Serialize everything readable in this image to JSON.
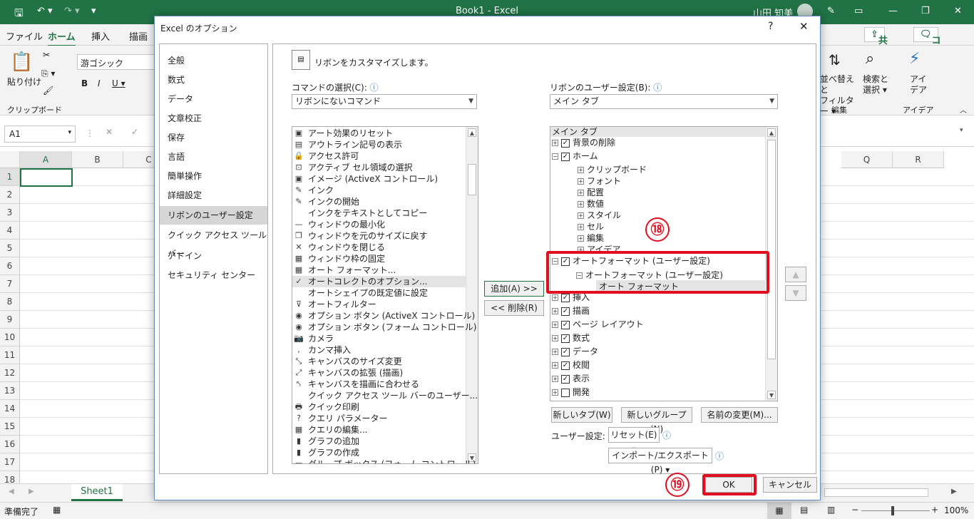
{
  "excel": {
    "window_title": "Book1  -  Excel",
    "user": "山田 知美",
    "tabs": [
      "ファイル",
      "ホーム",
      "挿入",
      "描画"
    ],
    "share": "共有",
    "comment": "コメント",
    "clipboard": {
      "paste": "貼り付け",
      "group": "クリップボード"
    },
    "font_name": "游ゴシック",
    "edit_group": {
      "sort": "並べ替えと",
      "filter": "フィルター",
      "find": "検索と",
      "select": "選択",
      "group": "編集"
    },
    "ideas": {
      "label": "アイ",
      "label2": "デア",
      "group": "アイデア"
    },
    "name_box": "A1",
    "columns": [
      "A",
      "B",
      "C",
      "Q",
      "R"
    ],
    "rows": [
      "1",
      "2",
      "3",
      "4",
      "5",
      "6",
      "7",
      "8",
      "9",
      "10",
      "11",
      "12",
      "13",
      "14",
      "15",
      "16",
      "17",
      "18"
    ],
    "sheet_tab": "Sheet1",
    "status": "準備完了",
    "zoom": "100%"
  },
  "dialog": {
    "title": "Excel のオプション",
    "help": "?",
    "close": "✕",
    "nav": [
      "全般",
      "数式",
      "データ",
      "文章校正",
      "保存",
      "言語",
      "簡単操作",
      "詳細設定",
      "リボンのユーザー設定",
      "クイック アクセス ツール バー",
      "アドイン",
      "セキュリティ センター"
    ],
    "heading": "リボンをカスタマイズします。",
    "commands_label": "コマンドの選択(C):",
    "commands_value": "リボンにないコマンド",
    "ribbon_label": "リボンのユーザー設定(B):",
    "ribbon_value": "メイン タブ",
    "command_list": [
      "アート効果のリセット",
      "アウトライン記号の表示",
      "アクセス許可",
      "アクティブ セル領域の選択",
      "イメージ (ActiveX コントロール)",
      "インク",
      "インクの開始",
      "インクをテキストとしてコピー",
      "ウィンドウの最小化",
      "ウィンドウを元のサイズに戻す",
      "ウィンドウを閉じる",
      "ウィンドウ枠の固定",
      "オート フォーマット...",
      "オートコレクトのオプション...",
      "オートシェイプの既定値に設定",
      "オートフィルター",
      "オプション ボタン (ActiveX コントロール)",
      "オプション ボタン (フォーム コントロール)",
      "カメラ",
      "カンマ挿入",
      "キャンバスのサイズ変更",
      "キャンバスの拡張 (描画)",
      "キャンバスを描画に合わせる",
      "クイック アクセス ツール バーのユーザー...",
      "クイック印刷",
      "クエリ パラメーター",
      "クエリの編集...",
      "グラフの追加",
      "グラフの作成",
      "グループ ボックス (フォーム コントロール)"
    ],
    "add_button": "追加(A) >>",
    "remove_button": "<< 削除(R)",
    "tree_header": "メイン タブ",
    "tree": [
      {
        "label": "背景の削除",
        "level": 0,
        "exp": "+",
        "chk": true
      },
      {
        "label": "ホーム",
        "level": 0,
        "exp": "−",
        "chk": true
      },
      {
        "label": "クリップボード",
        "level": 1,
        "exp": "+",
        "chk": false
      },
      {
        "label": "フォント",
        "level": 1,
        "exp": "+",
        "chk": false
      },
      {
        "label": "配置",
        "level": 1,
        "exp": "+",
        "chk": false
      },
      {
        "label": "数値",
        "level": 1,
        "exp": "+",
        "chk": false
      },
      {
        "label": "スタイル",
        "level": 1,
        "exp": "+",
        "chk": false
      },
      {
        "label": "セル",
        "level": 1,
        "exp": "+",
        "chk": false
      },
      {
        "label": "編集",
        "level": 1,
        "exp": "+",
        "chk": false
      },
      {
        "label": "アイデア",
        "level": 1,
        "exp": "+",
        "chk": false
      }
    ],
    "tree_custom": {
      "tab": "オートフォーマット (ユーザー設定)",
      "group": "オートフォーマット (ユーザー設定)",
      "command": "オート フォーマット"
    },
    "tree_rest": [
      {
        "label": "挿入",
        "chk": true
      },
      {
        "label": "描画",
        "chk": true
      },
      {
        "label": "ページ レイアウト",
        "chk": true
      },
      {
        "label": "数式",
        "chk": true
      },
      {
        "label": "データ",
        "chk": true
      },
      {
        "label": "校閲",
        "chk": true
      },
      {
        "label": "表示",
        "chk": true
      },
      {
        "label": "開発",
        "chk": false
      }
    ],
    "new_tab": "新しいタブ(W)",
    "new_group": "新しいグループ(N)",
    "rename": "名前の変更(M)...",
    "user_settings_label": "ユーザー設定:",
    "reset": "リセット(E) ▾",
    "import_export": "インポート/エクスポート(P) ▾",
    "ok": "OK",
    "cancel": "キャンセル",
    "badge18": "⑱",
    "badge19": "⑲"
  }
}
